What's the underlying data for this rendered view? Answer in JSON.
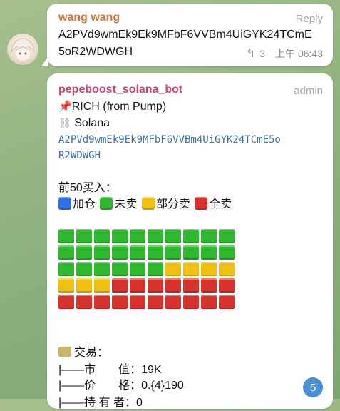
{
  "message1": {
    "sender": "wang wang",
    "reply_label": "Reply",
    "text_line1": "A2PVd9wmEk9Ek9MFbF6VVBm4UiGYK24TCmE",
    "text_line2": "5oR2WDWGH",
    "reply_count": "3",
    "time": "上午 06:43"
  },
  "message2": {
    "sender": "pepeboost_solana_bot",
    "role": "admin",
    "line_rich": "RICH (from Pump)",
    "line_chain": "Solana",
    "address_line1": "A2PVd9wmEk9Ek9MFbF6VVBm4UiGYK24TCmE5o",
    "address_line2": "R2WDWGH",
    "top_buyers_label": "前50买入：",
    "legend": [
      {
        "label": "加仓",
        "color": "#2f6fe8"
      },
      {
        "label": "未卖",
        "color": "#2db82d"
      },
      {
        "label": "部分卖",
        "color": "#f0c010"
      },
      {
        "label": "全卖",
        "color": "#d9312b"
      }
    ],
    "grid_rows": [
      [
        "green",
        "green",
        "green",
        "green",
        "green",
        "green",
        "green",
        "green",
        "green",
        "green"
      ],
      [
        "green",
        "green",
        "green",
        "green",
        "green",
        "green",
        "green",
        "green",
        "green",
        "green"
      ],
      [
        "green",
        "green",
        "green",
        "green",
        "green",
        "green",
        "yellow",
        "yellow",
        "yellow",
        "yellow"
      ],
      [
        "yellow",
        "yellow",
        "yellow",
        "red",
        "red",
        "red",
        "red",
        "red",
        "red",
        "red"
      ],
      [
        "red",
        "red",
        "red",
        "red",
        "red",
        "red",
        "red",
        "red",
        "red",
        "red"
      ]
    ],
    "trade_label": "交易：",
    "market_cap_line": "|——市　　值：19K",
    "price_line": "|——价　　格：0.{4}190",
    "cut_line": "|——持 有 者：0"
  },
  "unread_badge": "5",
  "colors": {
    "green": "#2db82d",
    "yellow": "#f0c010",
    "red": "#d9312b",
    "blue": "#2f6fe8",
    "sender1": "#d2753a",
    "sender2": "#c8456f"
  }
}
